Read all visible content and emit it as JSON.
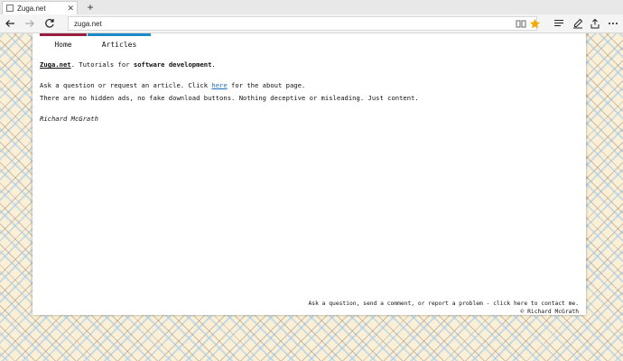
{
  "browser": {
    "tab_title": "Zuga.net",
    "tab_close": "✕",
    "new_tab": "+",
    "address": "zuga.net"
  },
  "nav": {
    "items": [
      {
        "label": "Home"
      },
      {
        "label": "Articles"
      }
    ]
  },
  "content": {
    "intro_brand": "Zuga.net",
    "intro_mid": ". Tutorials for ",
    "intro_bold": "software development",
    "intro_end": ".",
    "ask_pre": "Ask a question or request an article. Click ",
    "ask_link": "here",
    "ask_post": " for the about page.",
    "no_ads": "There are no hidden ads, no fake download buttons. Nothing deceptive or misleading. Just content.",
    "signature": "Richard McGrath"
  },
  "footer": {
    "contact": "Ask a question, send a comment, or report a problem - click here to contact me.",
    "copyright": "© Richard McGrath"
  },
  "colors": {
    "home_accent": "#9a1c3f",
    "articles_accent": "#1c89c8",
    "link": "#1f6fbf",
    "favorite_star": "#f2a900"
  },
  "icons": [
    "back-arrow-icon",
    "forward-arrow-icon",
    "refresh-icon",
    "favorite-star-icon",
    "hub-icon",
    "notes-icon",
    "share-icon",
    "more-icon"
  ]
}
